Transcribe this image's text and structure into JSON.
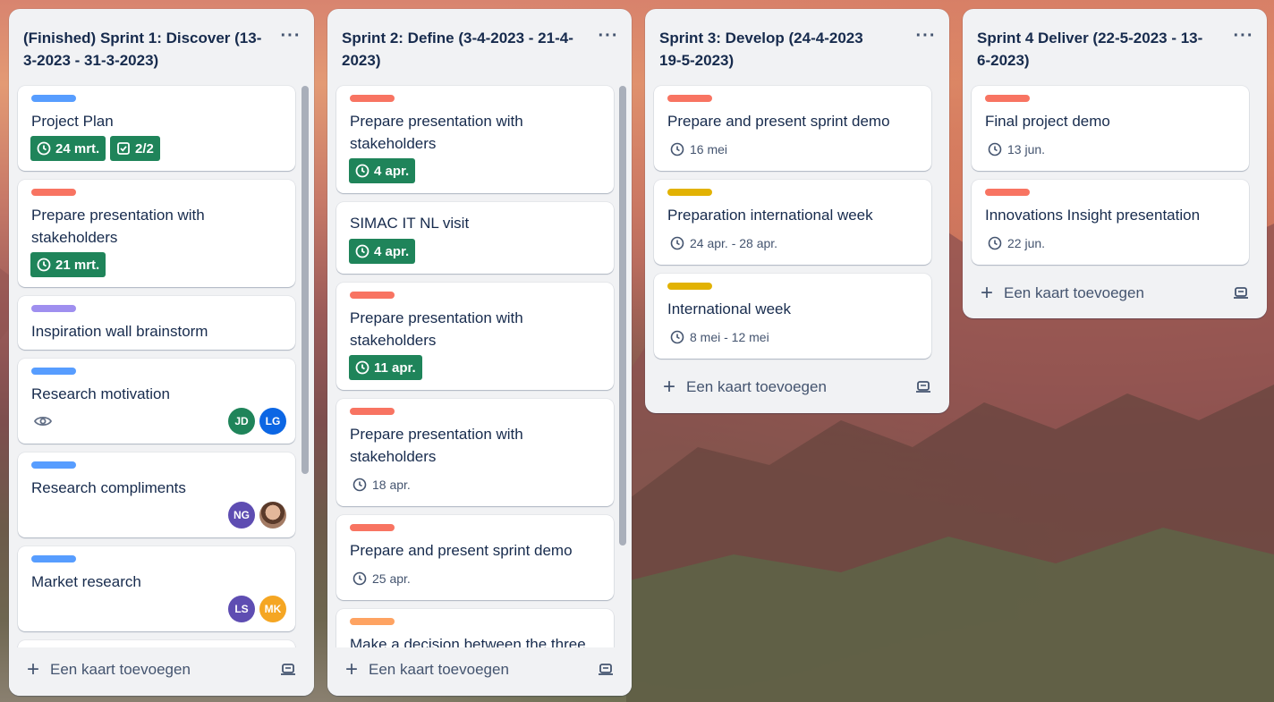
{
  "lists": [
    {
      "title": "(Finished) Sprint 1: Discover (13-3-2023 - 31-3-2023)",
      "menu_icon": "more-icon",
      "add_card_label": "Een kaart toevoegen",
      "cards": [
        {
          "title": "Project Plan",
          "label_color": "#579dff",
          "due": "24 mrt.",
          "checklist": "2/2"
        },
        {
          "title": "Prepare presentation with stakeholders",
          "label_color": "#f87462",
          "due": "21 mrt."
        },
        {
          "title": "Inspiration wall brainstorm",
          "label_color": "#9f8fef"
        },
        {
          "title": "Research motivation",
          "label_color": "#579dff",
          "watch_icon": "eye-icon",
          "members": [
            {
              "initials": "JD",
              "color": "#1f845a"
            },
            {
              "initials": "LG",
              "color": "#0c66e4"
            }
          ]
        },
        {
          "title": "Research compliments",
          "label_color": "#579dff",
          "members": [
            {
              "initials": "NG",
              "color": "#5e4db2"
            },
            {
              "initials": "",
              "color": "#8a6a5a"
            }
          ]
        },
        {
          "title": "Market research",
          "label_color": "#579dff",
          "members": [
            {
              "initials": "LS",
              "color": "#5e4db2"
            },
            {
              "initials": "MK",
              "color": "#f5a623"
            }
          ]
        }
      ]
    },
    {
      "title": "Sprint 2: Define (3-4-2023 - 21-4-2023)",
      "menu_icon": "more-icon",
      "add_card_label": "Een kaart toevoegen",
      "cards": [
        {
          "title": "Prepare presentation with stakeholders",
          "label_color": "#f87462",
          "due": "4 apr."
        },
        {
          "title": "SIMAC IT NL visit",
          "due": "4 apr."
        },
        {
          "title": "Prepare presentation with stakeholders",
          "label_color": "#f87462",
          "due": "11 apr."
        },
        {
          "title": "Prepare presentation with stakeholders",
          "label_color": "#f87462",
          "date": "18 apr."
        },
        {
          "title": "Prepare and present sprint demo",
          "label_color": "#f87462",
          "date": "25 apr."
        },
        {
          "title": "Make a decision between the three",
          "label_color": "#fea362"
        }
      ]
    },
    {
      "title": "Sprint 3: Develop (24-4-2023 19-5-2023)",
      "menu_icon": "more-icon",
      "add_card_label": "Een kaart toevoegen",
      "cards": [
        {
          "title": "Prepare and present sprint demo",
          "label_color": "#f87462",
          "date": "16 mei"
        },
        {
          "title": "Preparation international week",
          "label_color": "#e2b203",
          "date": "24 apr. - 28 apr."
        },
        {
          "title": "International week",
          "label_color": "#e2b203",
          "date": "8 mei - 12 mei"
        }
      ]
    },
    {
      "title": "Sprint 4 Deliver (22-5-2023 - 13-6-2023)",
      "menu_icon": "more-icon",
      "add_card_label": "Een kaart toevoegen",
      "cards": [
        {
          "title": "Final project demo",
          "label_color": "#f87462",
          "date": "13 jun."
        },
        {
          "title": "Innovations Insight presentation",
          "label_color": "#f87462",
          "date": "22 jun."
        }
      ]
    }
  ]
}
